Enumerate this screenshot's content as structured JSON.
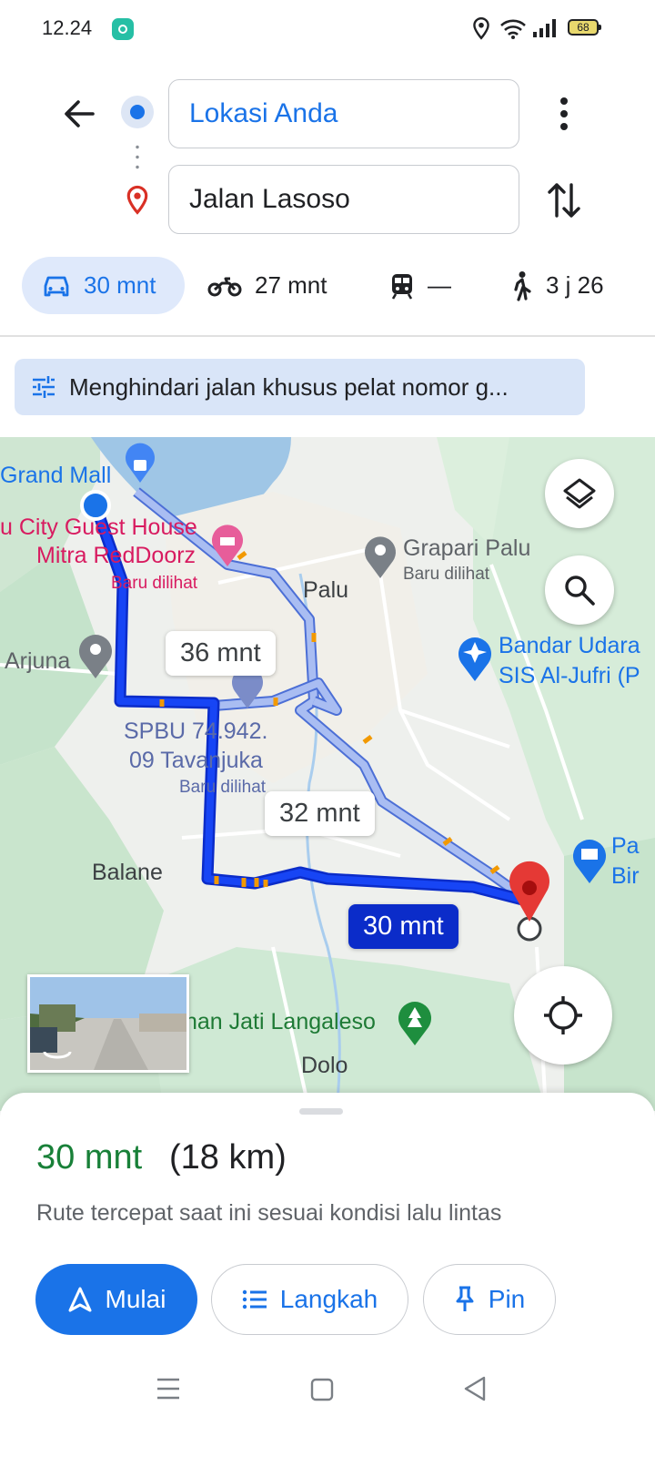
{
  "status_bar": {
    "time": "12.24",
    "battery": "68"
  },
  "route": {
    "origin": "Lokasi Anda",
    "destination": "Jalan Lasoso"
  },
  "modes": {
    "car": "30 mnt",
    "motorcycle": "27 mnt",
    "transit": "—",
    "walk": "3 j 26"
  },
  "avoid_chip": "Menghindari jalan khusus pelat nomor g...",
  "map": {
    "labels": {
      "grand_mall": "Grand Mall",
      "guest_house_1": "u City Guest House",
      "guest_house_2": "Mitra RedDoorz",
      "guest_house_sub": "Baru dilihat",
      "grapari": "Grapari Palu",
      "grapari_sub": "Baru dilihat",
      "palu": "Palu",
      "arjuna": "Arjuna",
      "airport_1": "Bandar Udara",
      "airport_2": "SIS Al-Jufri (P",
      "spbu_1": "SPBU 74.942.",
      "spbu_2": "09 Tavanjuka",
      "spbu_sub": "Baru dilihat",
      "balane": "Balane",
      "pasar_1": "Pa",
      "pasar_2": "Bir",
      "hutan": "nan Jati Langaleso",
      "dolo": "Dolo"
    },
    "bubbles": {
      "alt1": "36 mnt",
      "alt2": "32 mnt",
      "main": "30 mnt"
    }
  },
  "sheet": {
    "eta_time": "30 mnt",
    "eta_distance": "(18 km)",
    "description": "Rute tercepat saat ini sesuai kondisi lalu lintas",
    "start": "Mulai",
    "steps": "Langkah",
    "pin": "Pin"
  },
  "colors": {
    "accent": "#1a73e8",
    "route_main": "#0b2cc9",
    "route_alt": "#9fb4ef",
    "eta_green": "#188038",
    "destination_pin": "#e53935"
  }
}
